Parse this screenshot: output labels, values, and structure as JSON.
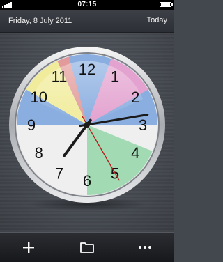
{
  "status_bar": {
    "time": "07:15"
  },
  "header": {
    "date": "Friday, 8 July 2011",
    "today_label": "Today"
  },
  "clock": {
    "numbers": [
      "1",
      "2",
      "3",
      "4",
      "5",
      "6",
      "7",
      "8",
      "9",
      "10",
      "11",
      "12"
    ],
    "hands": {
      "hour": 7,
      "minute": 13,
      "second": 25
    },
    "segment_colors": {
      "blue": "#8aaee0",
      "pink": "#e3a2cf",
      "green": "#a2dbb3",
      "white": "#efefef",
      "yellow": "#f1ec9c",
      "red": "#e39a9a"
    }
  },
  "toolbar": {
    "add_icon": "plus-icon",
    "folder_icon": "folder-icon",
    "more_icon": "more-icon"
  }
}
